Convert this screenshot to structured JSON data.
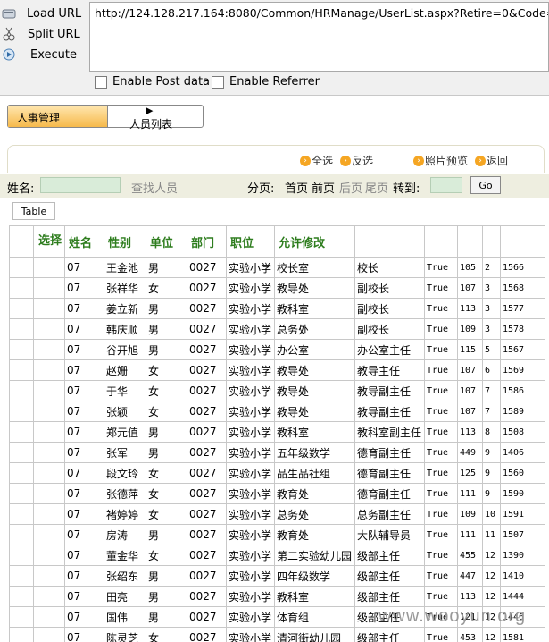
{
  "hackbar": {
    "load_url": "Load URL",
    "split_url": "Split URL",
    "execute": "Execute",
    "url": "http://124.128.217.164:8080/Common/HRManage/UserList.aspx?Retire=0&Code=",
    "enable_post": "Enable Post data",
    "enable_referrer": "Enable Referrer"
  },
  "tabs": {
    "tab1": "人事管理",
    "tab2": "人员列表"
  },
  "actions": {
    "select_all": "全选",
    "invert": "反选",
    "photo_preview": "照片预览",
    "back": "返回"
  },
  "search": {
    "name_label": "姓名:",
    "find_label": "查找人员",
    "page_label": "分页:",
    "first": "首页",
    "prev": "前页",
    "next": "后页",
    "last": "尾页",
    "goto": "转到:",
    "go": "Go"
  },
  "table_tag": "Table",
  "grid": {
    "headers": [
      "选择",
      "姓名",
      "性别",
      "单位",
      "部门",
      "职位",
      "允许修改"
    ],
    "rows": [
      [
        "07",
        "王金池",
        "男",
        "0027",
        "实验小学",
        "校长室",
        "校长",
        "True",
        "105",
        "2",
        "1566"
      ],
      [
        "07",
        "张祥华",
        "女",
        "0027",
        "实验小学",
        "教导处",
        "副校长",
        "True",
        "107",
        "3",
        "1568"
      ],
      [
        "07",
        "姜立新",
        "男",
        "0027",
        "实验小学",
        "教科室",
        "副校长",
        "True",
        "113",
        "3",
        "1577"
      ],
      [
        "07",
        "韩庆顺",
        "男",
        "0027",
        "实验小学",
        "总务处",
        "副校长",
        "True",
        "109",
        "3",
        "1578"
      ],
      [
        "07",
        "谷开旭",
        "男",
        "0027",
        "实验小学",
        "办公室",
        "办公室主任",
        "True",
        "115",
        "5",
        "1567"
      ],
      [
        "07",
        "赵姗",
        "女",
        "0027",
        "实验小学",
        "教导处",
        "教导主任",
        "True",
        "107",
        "6",
        "1569"
      ],
      [
        "07",
        "于华",
        "女",
        "0027",
        "实验小学",
        "教导处",
        "教导副主任",
        "True",
        "107",
        "7",
        "1586"
      ],
      [
        "07",
        "张颖",
        "女",
        "0027",
        "实验小学",
        "教导处",
        "教导副主任",
        "True",
        "107",
        "7",
        "1589"
      ],
      [
        "07",
        "郑元值",
        "男",
        "0027",
        "实验小学",
        "教科室",
        "教科室副主任",
        "True",
        "113",
        "8",
        "1508"
      ],
      [
        "07",
        "张军",
        "男",
        "0027",
        "实验小学",
        "五年级数学",
        "德育副主任",
        "True",
        "449",
        "9",
        "1406"
      ],
      [
        "07",
        "段文玲",
        "女",
        "0027",
        "实验小学",
        "品生品社组",
        "德育副主任",
        "True",
        "125",
        "9",
        "1560"
      ],
      [
        "07",
        "张德萍",
        "女",
        "0027",
        "实验小学",
        "教育处",
        "德育副主任",
        "True",
        "111",
        "9",
        "1590"
      ],
      [
        "07",
        "褚婷婷",
        "女",
        "0027",
        "实验小学",
        "总务处",
        "总务副主任",
        "True",
        "109",
        "10",
        "1591"
      ],
      [
        "07",
        "房涛",
        "男",
        "0027",
        "实验小学",
        "教育处",
        "大队辅导员",
        "True",
        "111",
        "11",
        "1507"
      ],
      [
        "07",
        "董金华",
        "女",
        "0027",
        "实验小学",
        "第二实验幼儿园",
        "级部主任",
        "True",
        "455",
        "12",
        "1390"
      ],
      [
        "07",
        "张绍东",
        "男",
        "0027",
        "实验小学",
        "四年级数学",
        "级部主任",
        "True",
        "447",
        "12",
        "1410"
      ],
      [
        "07",
        "田亮",
        "男",
        "0027",
        "实验小学",
        "教科室",
        "级部主任",
        "True",
        "113",
        "12",
        "1444"
      ],
      [
        "07",
        "国伟",
        "男",
        "0027",
        "实验小学",
        "体育组",
        "级部主任",
        "True",
        "121",
        "12",
        "1446"
      ],
      [
        "07",
        "陈灵芝",
        "女",
        "0027",
        "实验小学",
        "清河街幼儿园",
        "级部主任",
        "True",
        "453",
        "12",
        "1581"
      ]
    ]
  },
  "watermark": "www.wooyun.org"
}
